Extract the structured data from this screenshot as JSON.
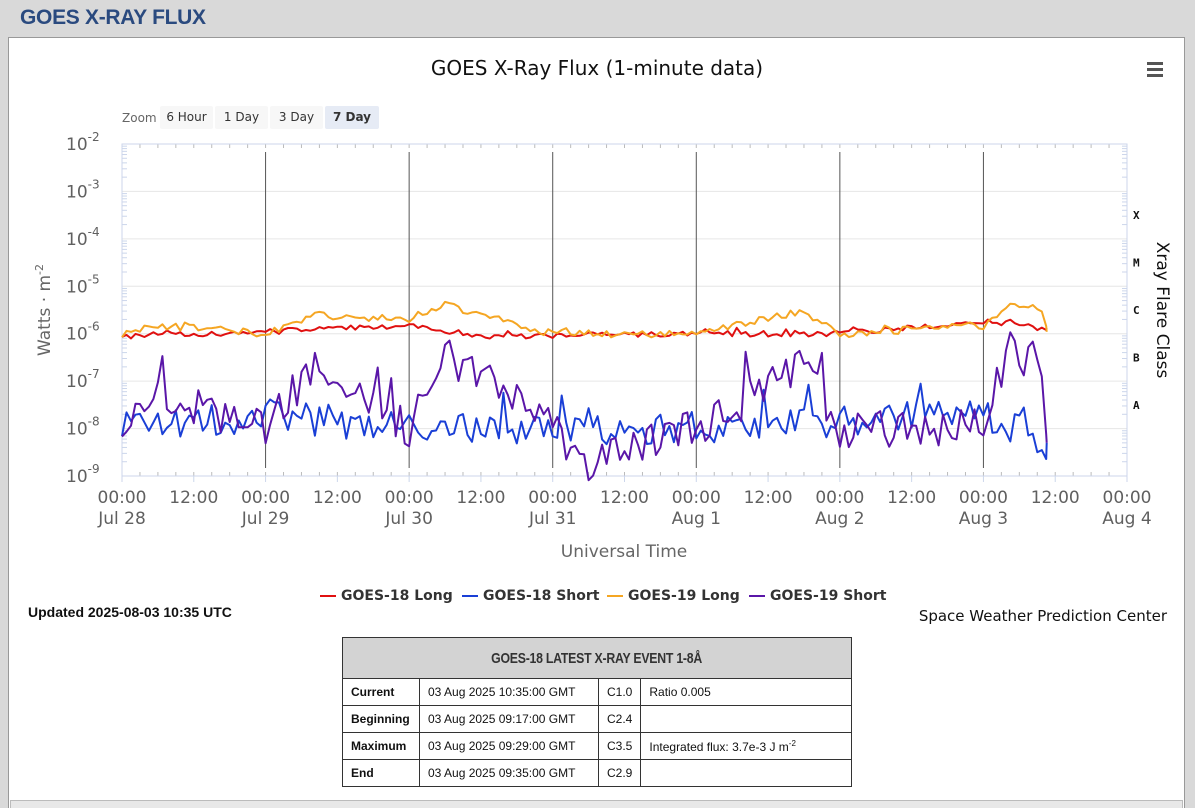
{
  "page": {
    "title": "GOES X-RAY FLUX"
  },
  "menu": {
    "icon": "hamburger-menu-icon"
  },
  "zoom": {
    "label": "Zoom",
    "buttons": [
      "6 Hour",
      "1 Day",
      "3 Day",
      "7 Day"
    ],
    "selected": "7 Day"
  },
  "updated": "Updated 2025-08-03 10:35 UTC",
  "credit": "Space Weather Prediction Center",
  "chart_data": {
    "type": "line",
    "title": "GOES X-Ray Flux (1-minute data)",
    "xlabel": "Universal Time",
    "ylabel": "Watts · m",
    "ylabel_sup": "-2",
    "y2label": "Xray Flare Class",
    "yscale": "log",
    "ylim": [
      "1e-9",
      "1e-2"
    ],
    "y_ticks": [
      {
        "base": "10",
        "exp": "-2"
      },
      {
        "base": "10",
        "exp": "-3"
      },
      {
        "base": "10",
        "exp": "-4"
      },
      {
        "base": "10",
        "exp": "-5"
      },
      {
        "base": "10",
        "exp": "-6"
      },
      {
        "base": "10",
        "exp": "-7"
      },
      {
        "base": "10",
        "exp": "-8"
      },
      {
        "base": "10",
        "exp": "-9"
      }
    ],
    "x_ticks": [
      {
        "time": "00:00",
        "date": "Jul 28"
      },
      {
        "time": "12:00",
        "date": ""
      },
      {
        "time": "00:00",
        "date": "Jul 29"
      },
      {
        "time": "12:00",
        "date": ""
      },
      {
        "time": "00:00",
        "date": "Jul 30"
      },
      {
        "time": "12:00",
        "date": ""
      },
      {
        "time": "00:00",
        "date": "Jul 31"
      },
      {
        "time": "12:00",
        "date": ""
      },
      {
        "time": "00:00",
        "date": "Aug 1"
      },
      {
        "time": "12:00",
        "date": ""
      },
      {
        "time": "00:00",
        "date": "Aug 2"
      },
      {
        "time": "12:00",
        "date": ""
      },
      {
        "time": "00:00",
        "date": "Aug 3"
      },
      {
        "time": "12:00",
        "date": ""
      },
      {
        "time": "00:00",
        "date": "Aug 4"
      }
    ],
    "xlim": [
      "2025-07-28 00:00",
      "2025-08-04 00:00"
    ],
    "flare_classes": [
      {
        "label": "X",
        "level": "1e-4"
      },
      {
        "label": "M",
        "level": "1e-5"
      },
      {
        "label": "C",
        "level": "1e-6"
      },
      {
        "label": "B",
        "level": "1e-7"
      },
      {
        "label": "A",
        "level": "1e-8"
      }
    ],
    "grid": true,
    "legend_position": "bottom-center",
    "series": [
      {
        "name": "GOES-18 Long",
        "color": "#e01010",
        "x": [
          "2025-07-28 00:00",
          "2025-07-29 00:00",
          "2025-07-30 00:00",
          "2025-07-30 12:00",
          "2025-07-31 00:00",
          "2025-08-01 00:00",
          "2025-08-02 00:00",
          "2025-08-03 00:00",
          "2025-08-03 10:35"
        ],
        "values": [
          "9e-7",
          "1.1e-6",
          "1.5e-6",
          "9e-7",
          "9e-7",
          "1e-6",
          "1e-6",
          "1.8e-6",
          "1.3e-6"
        ]
      },
      {
        "name": "GOES-18 Short",
        "color": "#1a3fd6",
        "x": [
          "2025-07-28 00:00",
          "2025-07-29 00:00",
          "2025-07-30 00:00",
          "2025-07-31 00:00",
          "2025-08-01 00:00",
          "2025-08-02 00:00",
          "2025-08-03 00:00",
          "2025-08-03 10:35"
        ],
        "values": [
          "1e-8",
          "2e-8",
          "1e-8",
          "1e-8",
          "1e-8",
          "1.5e-8",
          "2e-8",
          "5e-9"
        ]
      },
      {
        "name": "GOES-19 Long",
        "color": "#f5a623",
        "x": [
          "2025-07-28 00:00",
          "2025-07-28 06:00",
          "2025-07-29 00:00",
          "2025-07-29 08:00",
          "2025-07-30 00:00",
          "2025-07-30 06:00",
          "2025-07-31 00:00",
          "2025-08-01 00:00",
          "2025-08-01 18:00",
          "2025-08-02 00:00",
          "2025-08-03 00:00",
          "2025-08-03 04:00",
          "2025-08-03 09:30",
          "2025-08-03 10:35"
        ],
        "values": [
          "9e-7",
          "1.5e-6",
          "1e-6",
          "2.5e-6",
          "2e-6",
          "4e-6",
          "1e-6",
          "1e-6",
          "3e-6",
          "1e-6",
          "1.5e-6",
          "4e-6",
          "3.5e-6",
          "1.1e-6"
        ]
      },
      {
        "name": "GOES-19 Short",
        "color": "#5a16a8",
        "x": [
          "2025-07-28 00:00",
          "2025-07-28 06:00",
          "2025-07-29 00:00",
          "2025-07-29 08:00",
          "2025-07-30 00:00",
          "2025-07-30 06:00",
          "2025-07-31 00:00",
          "2025-07-31 06:00",
          "2025-08-01 00:00",
          "2025-08-01 18:00",
          "2025-08-02 00:00",
          "2025-08-03 00:00",
          "2025-08-03 04:00",
          "2025-08-03 09:30",
          "2025-08-03 10:35"
        ],
        "values": [
          "1e-8",
          "5e-8",
          "1e-8",
          "2e-7",
          "1e-8",
          "4e-7",
          "1e-8",
          "2e-9",
          "1e-8",
          "2e-7",
          "1e-8",
          "1e-8",
          "4e-7",
          "2.5e-7",
          "5e-9"
        ]
      }
    ]
  },
  "event_table": {
    "title": "GOES-18 LATEST X-RAY EVENT 1-8Å",
    "rows": [
      {
        "label": "Current",
        "time": "03 Aug 2025 10:35:00 GMT",
        "class": "C1.0",
        "extra": "Ratio 0.005",
        "extra_sup": ""
      },
      {
        "label": "Beginning",
        "time": "03 Aug 2025 09:17:00 GMT",
        "class": "C2.4",
        "extra": "",
        "extra_sup": ""
      },
      {
        "label": "Maximum",
        "time": "03 Aug 2025 09:29:00 GMT",
        "class": "C3.5",
        "extra": "Integrated flux: 3.7e-3 J m",
        "extra_sup": "-2"
      },
      {
        "label": "End",
        "time": "03 Aug 2025 09:35:00 GMT",
        "class": "C2.9",
        "extra": "",
        "extra_sup": ""
      }
    ]
  }
}
